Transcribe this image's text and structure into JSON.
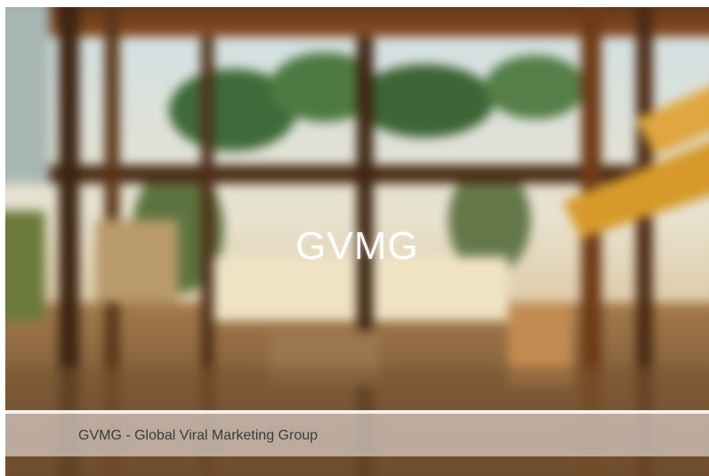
{
  "hero": {
    "title": "GVMG",
    "image": "blurred-tropical-resort-view-image"
  },
  "caption": {
    "text": "GVMG - Global Viral Marketing Group"
  },
  "colors": {
    "caption_background": "#d7cdc8",
    "caption_text": "#3b3b3b",
    "divider": "#ffffff",
    "title": "#ffffff"
  }
}
